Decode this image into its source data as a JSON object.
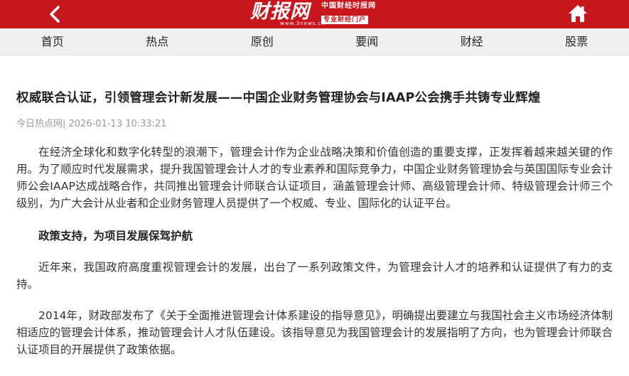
{
  "header": {
    "logo_text": "财报网",
    "logo_tagline_1": "中国财经时报网",
    "logo_tagline_2": "专业财经门户",
    "logo_url": "www.3news.cn",
    "back_icon": "chevron-left-icon",
    "home_icon": "home-icon",
    "background_color": "#c8161d"
  },
  "nav": {
    "items": [
      {
        "label": "首页"
      },
      {
        "label": "热点"
      },
      {
        "label": "原创"
      },
      {
        "label": "要闻"
      },
      {
        "label": "财经"
      },
      {
        "label": "股票"
      }
    ]
  },
  "article": {
    "title": "权威联合认证，引领管理会计新发展——中国企业财务管理协会与IAAP公会携手共铸专业辉煌",
    "meta": "今日热点网| 2026-01-13 10:33:21",
    "paragraphs": [
      "在经济全球化和数字化转型的浪潮下，管理会计作为企业战略决策和价值创造的重要支撑，正发挥着越来越关键的作用。为了顺应时代发展需求，提升我国管理会计人才的专业素养和国际竞争力，中国企业财务管理协会与英国国际专业会计师公会IAAP达成战略合作，共同推出管理会计师联合认证项目，涵盖管理会计师、高级管理会计师、特级管理会计师三个级别，为广大会计从业者和企业财务管理人员提供了一个权威、专业、国际化的认证平台。"
    ],
    "subheading_1": "政策支持，为项目发展保驾护航",
    "paragraphs_2": [
      "近年来，我国政府高度重视管理会计的发展，出台了一系列政策文件，为管理会计人才的培养和认证提供了有力的支持。",
      "2014年，财政部发布了《关于全面推进管理会计体系建设的指导意见》，明确提出要建立与我国社会主义市场经济体制相适应的管理会计体系，推动管理会计人才队伍建设。该指导意见为我国管理会计的发展指明了方向，也为管理会计师联合认证项目的开展提供了政策依据。"
    ]
  }
}
